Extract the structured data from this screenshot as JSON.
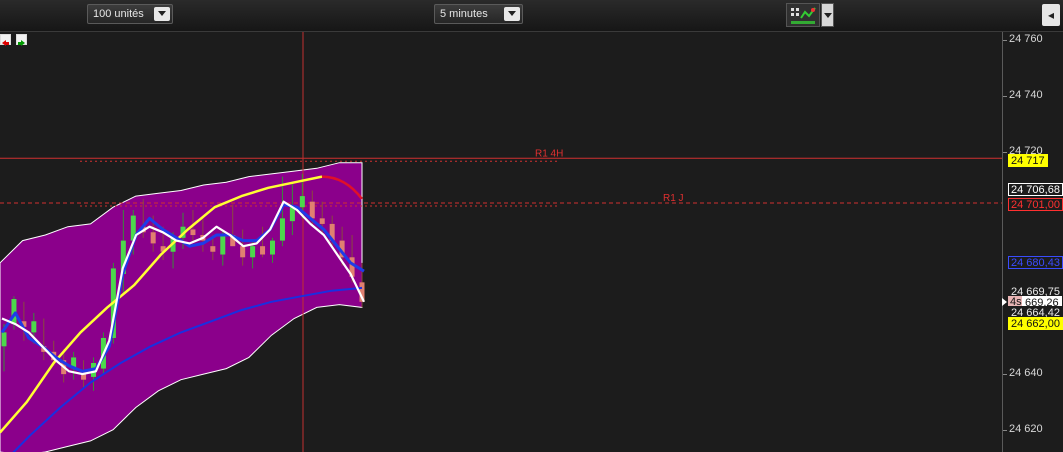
{
  "toolbar": {
    "units_select": "100 unités",
    "interval_select": "5 minutes",
    "corner_glyph": "◂"
  },
  "colors": {
    "background": "#1c1c1c",
    "band_fill": "#8b008b",
    "band_border": "#ffffff",
    "ma_yellow": "#ffff33",
    "ma_blue": "#1e3ce8",
    "ma_dark_blue": "#1a2fe0",
    "ma_white": "#ffffff",
    "bull_candle": "#4cd94c",
    "bear_candle": "#e08070",
    "level_line": "#d03030"
  },
  "chart_data": {
    "type": "candlestick",
    "y_range": [
      24612,
      24763
    ],
    "y_ticks": [
      "24 760",
      "24 740",
      "24 720",
      "24 640",
      "24 620"
    ],
    "levels": [
      {
        "label": "R1 4H",
        "value": 24717.6
      },
      {
        "label": "R1 J",
        "value": 24701.5
      }
    ],
    "price_tags": [
      {
        "text": "24 717",
        "value": 24717,
        "style": "yellow"
      },
      {
        "text": "24 706,68",
        "value": 24706.7,
        "style": "white"
      },
      {
        "text": "24 701,00",
        "value": 24701,
        "style": "red"
      },
      {
        "text": "24 680,43",
        "value": 24680.4,
        "style": "blue"
      },
      {
        "text": "24 669,75",
        "value": 24669.8,
        "style": "plain"
      },
      {
        "text": "669,26",
        "value": 24665.8,
        "style": "countdown",
        "prefix": "4s"
      },
      {
        "text": "24 664,42",
        "value": 24662.2,
        "style": "plain"
      },
      {
        "text": "24 662,00",
        "value": 24658.4,
        "style": "yellow"
      }
    ],
    "candles": [
      {
        "o": 24650,
        "h": 24658,
        "l": 24641,
        "c": 24655
      },
      {
        "o": 24658,
        "h": 24668,
        "l": 24656,
        "c": 24667
      },
      {
        "o": 24659,
        "h": 24666,
        "l": 24652,
        "c": 24657
      },
      {
        "o": 24655,
        "h": 24662,
        "l": 24651,
        "c": 24659
      },
      {
        "o": 24650,
        "h": 24660,
        "l": 24645,
        "c": 24648
      },
      {
        "o": 24648,
        "h": 24652,
        "l": 24643,
        "c": 24645
      },
      {
        "o": 24645,
        "h": 24649,
        "l": 24637,
        "c": 24640
      },
      {
        "o": 24642,
        "h": 24648,
        "l": 24638,
        "c": 24646
      },
      {
        "o": 24640,
        "h": 24645,
        "l": 24635,
        "c": 24638
      },
      {
        "o": 24639,
        "h": 24646,
        "l": 24634,
        "c": 24644
      },
      {
        "o": 24642,
        "h": 24655,
        "l": 24640,
        "c": 24653
      },
      {
        "o": 24653,
        "h": 24680,
        "l": 24651,
        "c": 24678
      },
      {
        "o": 24676,
        "h": 24699,
        "l": 24669,
        "c": 24688
      },
      {
        "o": 24688,
        "h": 24699,
        "l": 24683,
        "c": 24697
      },
      {
        "o": 24693,
        "h": 24703,
        "l": 24689,
        "c": 24691
      },
      {
        "o": 24691,
        "h": 24697,
        "l": 24684,
        "c": 24687
      },
      {
        "o": 24686,
        "h": 24693,
        "l": 24681,
        "c": 24684
      },
      {
        "o": 24684,
        "h": 24691,
        "l": 24678,
        "c": 24689
      },
      {
        "o": 24689,
        "h": 24698,
        "l": 24685,
        "c": 24693
      },
      {
        "o": 24692,
        "h": 24699,
        "l": 24688,
        "c": 24690
      },
      {
        "o": 24690,
        "h": 24696,
        "l": 24684,
        "c": 24688
      },
      {
        "o": 24686,
        "h": 24690,
        "l": 24681,
        "c": 24684
      },
      {
        "o": 24683,
        "h": 24692,
        "l": 24679,
        "c": 24690
      },
      {
        "o": 24690,
        "h": 24701,
        "l": 24686,
        "c": 24686
      },
      {
        "o": 24686,
        "h": 24692,
        "l": 24679,
        "c": 24682
      },
      {
        "o": 24682,
        "h": 24688,
        "l": 24678,
        "c": 24686
      },
      {
        "o": 24686,
        "h": 24693,
        "l": 24682,
        "c": 24683
      },
      {
        "o": 24683,
        "h": 24689,
        "l": 24680,
        "c": 24688
      },
      {
        "o": 24688,
        "h": 24711,
        "l": 24686,
        "c": 24696
      },
      {
        "o": 24695,
        "h": 24709,
        "l": 24690,
        "c": 24700
      },
      {
        "o": 24700,
        "h": 24712,
        "l": 24696,
        "c": 24704
      },
      {
        "o": 24702,
        "h": 24706,
        "l": 24693,
        "c": 24696
      },
      {
        "o": 24696,
        "h": 24702,
        "l": 24690,
        "c": 24694
      },
      {
        "o": 24694,
        "h": 24697,
        "l": 24686,
        "c": 24688
      },
      {
        "o": 24688,
        "h": 24693,
        "l": 24679,
        "c": 24682
      },
      {
        "o": 24682,
        "h": 24690,
        "l": 24673,
        "c": 24675
      },
      {
        "o": 24673,
        "h": 24680,
        "l": 24664,
        "c": 24666
      }
    ],
    "band_upper": [
      24680,
      24688,
      24690,
      24693,
      24694,
      24700,
      24704,
      24705,
      24706,
      24708,
      24709,
      24711,
      24712,
      24713,
      24714,
      24716,
      24716
    ],
    "band_lower": [
      24612,
      24611,
      24612,
      24614,
      24616,
      24620,
      24628,
      24634,
      24638,
      24640,
      24642,
      24646,
      24654,
      24660,
      24664,
      24665,
      24664
    ],
    "ma_yellow": [
      24619,
      24630,
      24644,
      24655,
      24664,
      24672,
      24683,
      24692,
      24700,
      24704,
      24707,
      24709,
      24711
    ],
    "ma_dark_blue": [
      24607,
      24618,
      24628,
      24637,
      24644,
      24650,
      24655,
      24659,
      24663,
      24666,
      24668,
      24670,
      24671
    ],
    "ma_white": [
      24660,
      24658,
      24655,
      24650,
      24645,
      24641,
      24640,
      24641,
      24652,
      24678,
      24690,
      24693,
      24691,
      24688,
      24687,
      24689,
      24693,
      24690,
      24686,
      24687,
      24692,
      24702,
      24699,
      24694,
      24690,
      24683,
      24676,
      24666
    ],
    "ma_blue": [
      24655,
      24662,
      24653,
      24650,
      24646,
      24643,
      24641,
      24642,
      24650,
      24676,
      24690,
      24696,
      24692,
      24689,
      24686,
      24687,
      24690,
      24690,
      24688,
      24688,
      24692,
      24701,
      24700,
      24696,
      24692,
      24686,
      24680,
      24677
    ]
  }
}
